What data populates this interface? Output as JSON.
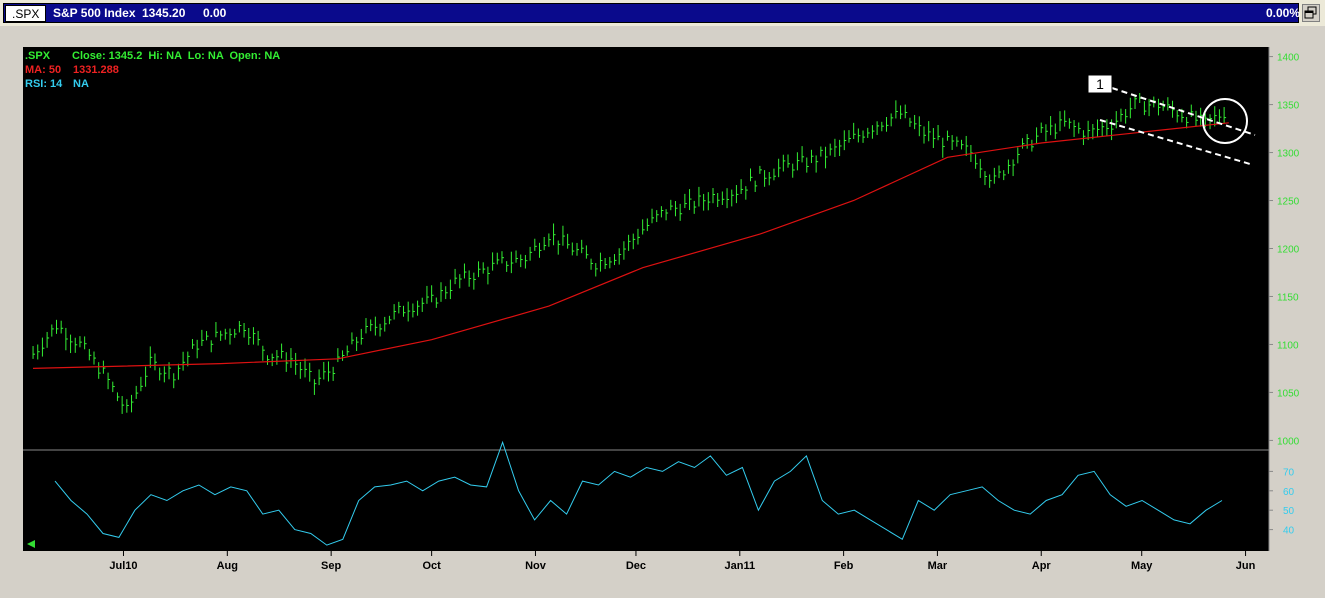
{
  "header": {
    "symbol_tab": ".SPX",
    "name": "S&P 500 Index",
    "last": "1345.20",
    "change": "0.00",
    "pct_change": "0.00%"
  },
  "legend": {
    "symbol": ".SPX",
    "ohlc_text": "Close: 1345.2  Hi: NA  Lo: NA  Open: NA",
    "ma_label": "MA: 50",
    "ma_value": "1331.288",
    "rsi_label": "RSI: 14",
    "rsi_value": "NA"
  },
  "annotation_label": "1",
  "colors": {
    "background": "#000000",
    "price_bars": "#33ee33",
    "ma_line": "#dd1111",
    "rsi_line": "#33ccee",
    "axis_text_price": "#33dd33",
    "axis_text_rsi": "#33ccee",
    "header_bg": "#0a0a8c"
  },
  "chart_data": [
    {
      "type": "ohlc",
      "series": [
        {
          "name": ".SPX",
          "x": [
            "2010-06-04",
            "2010-06-11",
            "2010-06-18",
            "2010-06-25",
            "2010-07-02",
            "2010-07-09",
            "2010-07-16",
            "2010-07-23",
            "2010-07-30",
            "2010-08-06",
            "2010-08-13",
            "2010-08-20",
            "2010-08-27",
            "2010-09-03",
            "2010-09-10",
            "2010-09-17",
            "2010-09-24",
            "2010-10-01",
            "2010-10-08",
            "2010-10-15",
            "2010-10-22",
            "2010-10-29",
            "2010-11-05",
            "2010-11-12",
            "2010-11-19",
            "2010-11-26",
            "2010-12-03",
            "2010-12-10",
            "2010-12-17",
            "2010-12-24",
            "2010-12-31",
            "2011-01-07",
            "2011-01-14",
            "2011-01-21",
            "2011-01-28",
            "2011-02-04",
            "2011-02-11",
            "2011-02-18",
            "2011-02-25",
            "2011-03-04",
            "2011-03-11",
            "2011-03-18",
            "2011-03-25",
            "2011-04-01",
            "2011-04-08",
            "2011-04-15",
            "2011-04-22",
            "2011-04-29",
            "2011-05-06",
            "2011-05-13",
            "2011-05-20",
            "2011-05-27"
          ],
          "values": [
            1090,
            1120,
            1100,
            1070,
            1030,
            1080,
            1070,
            1100,
            1110,
            1120,
            1090,
            1085,
            1060,
            1080,
            1110,
            1125,
            1140,
            1145,
            1165,
            1175,
            1185,
            1190,
            1215,
            1200,
            1185,
            1195,
            1220,
            1240,
            1245,
            1255,
            1260,
            1275,
            1285,
            1290,
            1300,
            1315,
            1330,
            1340,
            1320,
            1310,
            1300,
            1270,
            1300,
            1320,
            1330,
            1320,
            1330,
            1350,
            1350,
            1340,
            1330,
            1345
          ]
        },
        {
          "name": "MA: 50",
          "x": [
            "2010-06-04",
            "2010-07-30",
            "2010-09-03",
            "2010-10-01",
            "2010-11-05",
            "2010-12-03",
            "2011-01-07",
            "2011-02-04",
            "2011-03-04",
            "2011-04-01",
            "2011-05-27"
          ],
          "values": [
            1075,
            1080,
            1085,
            1105,
            1140,
            1180,
            1215,
            1250,
            1295,
            1310,
            1331
          ]
        }
      ],
      "ylim": [
        990,
        1410
      ],
      "yticks": [
        "1400",
        "1350",
        "1300",
        "1250",
        "1200",
        "1150",
        "1100",
        "1050",
        "1000"
      ],
      "categories": [
        "Jul10",
        "Aug",
        "Sep",
        "Oct",
        "Nov",
        "Dec",
        "Jan11",
        "Feb",
        "Mar",
        "Apr",
        "May",
        "Jun"
      ]
    },
    {
      "type": "line",
      "series": [
        {
          "name": "RSI: 14",
          "values": [
            65,
            55,
            48,
            38,
            36,
            50,
            58,
            55,
            60,
            63,
            58,
            62,
            60,
            48,
            50,
            40,
            38,
            32,
            35,
            55,
            62,
            63,
            65,
            60,
            65,
            67,
            63,
            62,
            85,
            60,
            45,
            55,
            48,
            65,
            63,
            70,
            67,
            72,
            70,
            75,
            72,
            78,
            68,
            72,
            50,
            65,
            70,
            78,
            55,
            48,
            50,
            45,
            40,
            35,
            55,
            50,
            58,
            60,
            62,
            55,
            50,
            48,
            55,
            58,
            68,
            70,
            58,
            52,
            55,
            50,
            45,
            43,
            50,
            55
          ]
        }
      ],
      "ylim": [
        30,
        80
      ],
      "yticks": [
        "70",
        "60",
        "50",
        "40"
      ]
    }
  ]
}
